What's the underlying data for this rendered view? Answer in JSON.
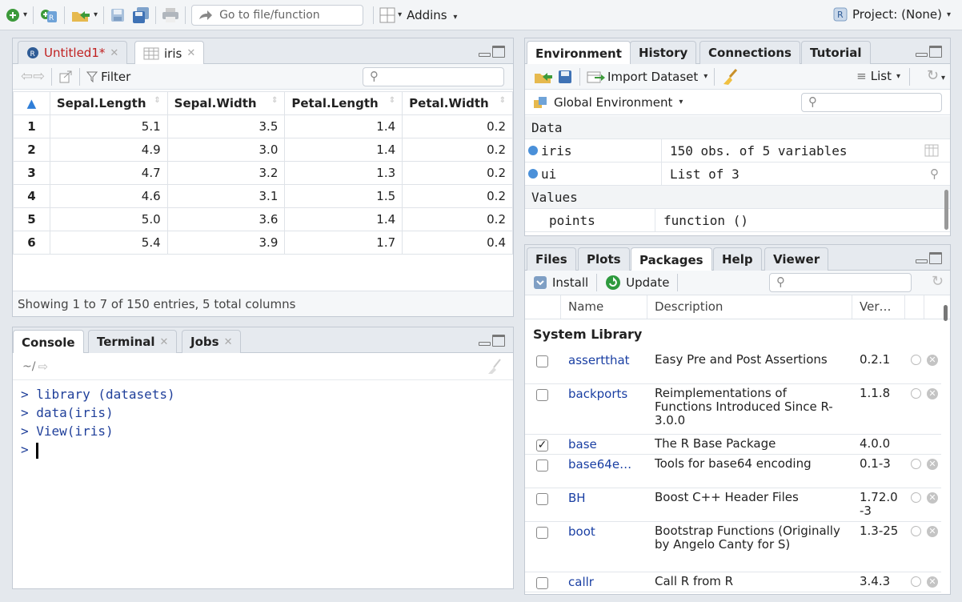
{
  "toolbar": {
    "goto_placeholder": "Go to file/function",
    "addins_label": "Addins",
    "project_label": "Project: (None)"
  },
  "source_pane": {
    "tabs": [
      {
        "label": "Untitled1*",
        "modified": true
      },
      {
        "label": "iris",
        "modified": false
      }
    ],
    "filter_label": "Filter",
    "columns": [
      "Sepal.Length",
      "Sepal.Width",
      "Petal.Length",
      "Petal.Width"
    ],
    "rows": [
      {
        "n": "1",
        "v": [
          "5.1",
          "3.5",
          "1.4",
          "0.2"
        ]
      },
      {
        "n": "2",
        "v": [
          "4.9",
          "3.0",
          "1.4",
          "0.2"
        ]
      },
      {
        "n": "3",
        "v": [
          "4.7",
          "3.2",
          "1.3",
          "0.2"
        ]
      },
      {
        "n": "4",
        "v": [
          "4.6",
          "3.1",
          "1.5",
          "0.2"
        ]
      },
      {
        "n": "5",
        "v": [
          "5.0",
          "3.6",
          "1.4",
          "0.2"
        ]
      },
      {
        "n": "6",
        "v": [
          "5.4",
          "3.9",
          "1.7",
          "0.4"
        ]
      }
    ],
    "status": "Showing 1 to 7 of 150 entries, 5 total columns"
  },
  "console_pane": {
    "tabs": [
      {
        "label": "Console"
      },
      {
        "label": "Terminal"
      },
      {
        "label": "Jobs"
      }
    ],
    "path": "~/",
    "lines": [
      "> library (datasets)",
      "> data(iris)",
      "> View(iris)",
      ">"
    ]
  },
  "env_pane": {
    "tabs": [
      "Environment",
      "History",
      "Connections",
      "Tutorial"
    ],
    "import_label": "Import Dataset",
    "list_label": "List",
    "scope_label": "Global Environment",
    "sections": {
      "data": "Data",
      "values": "Values"
    },
    "data_items": [
      {
        "name": "iris",
        "value": "150 obs. of 5 variables"
      },
      {
        "name": "ui",
        "value": "List of 3"
      }
    ],
    "value_items": [
      {
        "name": "points",
        "value": "function ()"
      }
    ]
  },
  "files_pane": {
    "tabs": [
      "Files",
      "Plots",
      "Packages",
      "Help",
      "Viewer"
    ],
    "install_label": "Install",
    "update_label": "Update",
    "headers": {
      "name": "Name",
      "description": "Description",
      "version": "Ver…"
    },
    "section": "System Library",
    "packages": [
      {
        "name": "assertthat",
        "desc": "Easy Pre and Post Assertions",
        "ver": "0.2.1",
        "checked": false
      },
      {
        "name": "backports",
        "desc": "Reimplementations of Functions Introduced Since R-3.0.0",
        "ver": "1.1.8",
        "checked": false
      },
      {
        "name": "base",
        "desc": "The R Base Package",
        "ver": "4.0.0",
        "checked": true
      },
      {
        "name": "base64e…",
        "desc": "Tools for base64 encoding",
        "ver": "0.1-3",
        "checked": false
      },
      {
        "name": "BH",
        "desc": "Boost C++ Header Files",
        "ver": "1.72.0-3",
        "checked": false
      },
      {
        "name": "boot",
        "desc": "Bootstrap Functions (Originally by Angelo Canty for S)",
        "ver": "1.3-25",
        "checked": false
      },
      {
        "name": "callr",
        "desc": "Call R from R",
        "ver": "3.4.3",
        "checked": false
      }
    ]
  }
}
